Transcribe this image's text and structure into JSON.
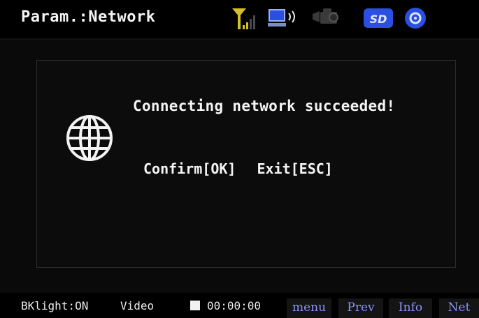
{
  "header": {
    "title": "Param.:Network",
    "icons": [
      "antenna-signal-icon",
      "computer-audio-icon",
      "camera-icon",
      "sd-card-icon",
      "disc-icon"
    ],
    "sd_label": "SD"
  },
  "dialog": {
    "icon": "globe-icon",
    "message": "Connecting network succeeded!",
    "confirm_label": "Confirm[OK]",
    "exit_label": "Exit[ESC]"
  },
  "footer": {
    "backlight": "BKlight:ON",
    "mode": "Video",
    "timer": "00:00:00",
    "soft_keys": [
      "menu",
      "Prev",
      "Info",
      "Net"
    ]
  },
  "colors": {
    "icon_yellow": "#d4c02a",
    "icon_blue": "#2b4fe0",
    "softkey_text": "#8c90ff"
  }
}
